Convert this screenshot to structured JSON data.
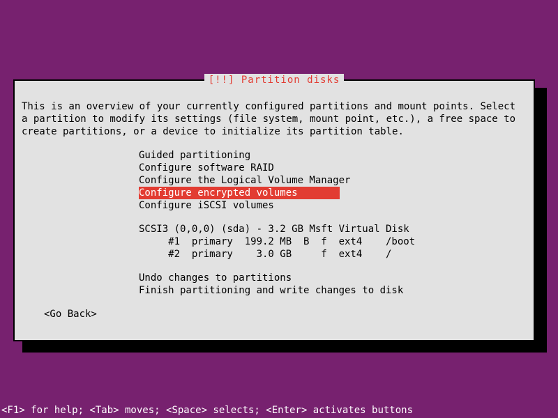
{
  "dialog": {
    "title": "[!!] Partition disks",
    "intro": "This is an overview of your currently configured partitions and mount points. Select a partition to modify its settings (file system, mount point, etc.), a free space to create partitions, or a device to initialize its partition table."
  },
  "menu": {
    "items": [
      {
        "label": "Guided partitioning",
        "selected": false
      },
      {
        "label": "Configure software RAID",
        "selected": false
      },
      {
        "label": "Configure the Logical Volume Manager",
        "selected": false
      },
      {
        "label": "Configure encrypted volumes",
        "selected": true
      },
      {
        "label": "Configure iSCSI volumes",
        "selected": false
      }
    ]
  },
  "disk": {
    "header": "SCSI3 (0,0,0) (sda) - 3.2 GB Msft Virtual Disk",
    "partitions": [
      "     #1  primary  199.2 MB  B  f  ext4    /boot",
      "     #2  primary    3.0 GB     f  ext4    /"
    ]
  },
  "actions": {
    "undo": "Undo changes to partitions",
    "finish": "Finish partitioning and write changes to disk"
  },
  "goback": "<Go Back>",
  "help": "<F1> for help; <Tab> moves; <Space> selects; <Enter> activates buttons"
}
